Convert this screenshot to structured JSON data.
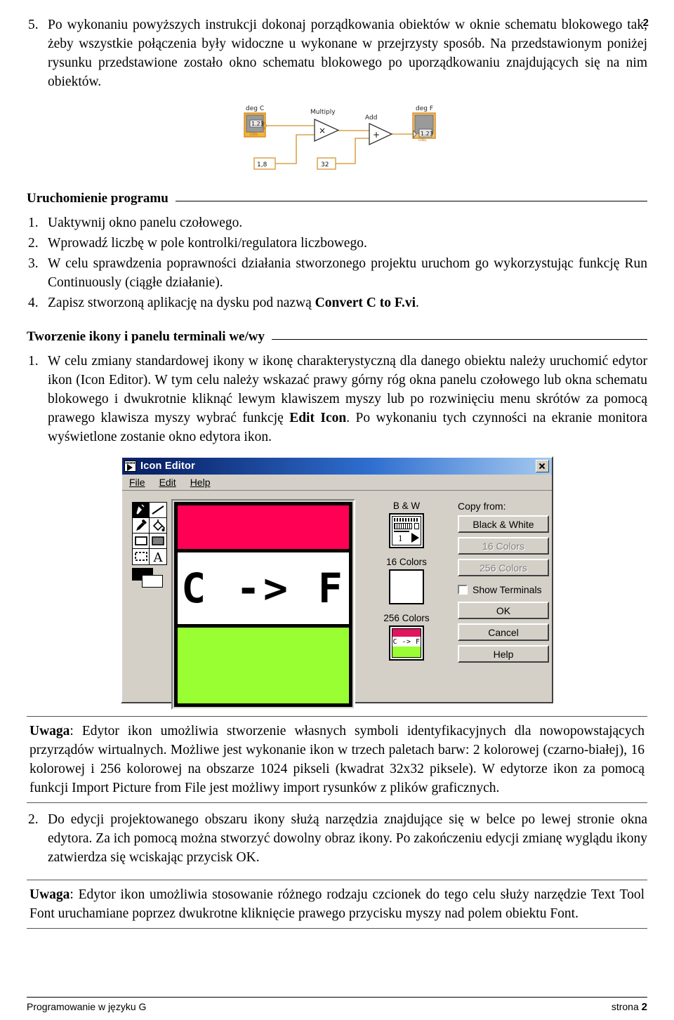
{
  "page": {
    "number_top": "2",
    "footer_left": "Programowanie w języku G",
    "footer_right_label": "strona",
    "footer_right_num": "2"
  },
  "intro": {
    "number": "5.",
    "text": "Po wykonaniu powyższych instrukcji dokonaj porządkowania obiektów w oknie schematu blokowego tak, żeby wszystkie połączenia były widoczne u wykonane w przejrzysty sposób. Na przedstawionym poniżej rysunku przedstawione zostało okno schematu blokowego po uporządkowaniu znajdujących się na nim obiektów."
  },
  "block_diagram": {
    "input_label": "deg C",
    "input_value": "1.23",
    "input_type": "DBL",
    "multiply_label": "Multiply",
    "multiply_symbol": "×",
    "add_label": "Add",
    "add_symbol": "+",
    "constant_multiply": "1,8",
    "constant_add": "32",
    "output_label": "deg F",
    "output_value": "1.23",
    "output_type": "DBL",
    "wire_color": "#e0a030"
  },
  "section_run": {
    "heading": "Uruchomienie programu",
    "items": [
      {
        "num": "1.",
        "text": "Uaktywnij okno panelu czołowego."
      },
      {
        "num": "2.",
        "text": "Wprowadź liczbę w pole kontrolki/regulatora liczbowego."
      },
      {
        "num": "3.",
        "text": "W celu sprawdzenia poprawności działania stworzonego projektu uruchom go wykorzystując funkcję Run Continuously (ciągłe działanie)."
      },
      {
        "num": "4.",
        "text": "Zapisz stworzoną aplikację na dysku pod nazwą ",
        "bold_tail": "Convert C to F.vi",
        "tail": "."
      }
    ]
  },
  "section_icon": {
    "heading": "Tworzenie ikony i panelu terminali we/wy",
    "item1": {
      "num": "1.",
      "part1": "W celu zmiany standardowej ikony w ikonę charakterystyczną dla danego obiektu należy uruchomić edytor ikon (Icon Editor). W tym celu należy wskazać prawy górny róg okna panelu czołowego lub okna schematu blokowego i dwukrotnie kliknąć lewym klawiszem myszy lub po rozwinięciu menu skrótów za pomocą prawego klawisza myszy wybrać funkcję ",
      "bold": "Edit Icon",
      "part2": ". Po wykonaniu tych czynności na ekranie monitora wyświetlone zostanie okno edytora ikon."
    },
    "item2": {
      "num": "2.",
      "text": "Do edycji projektowanego obszaru ikony służą narzędzia znajdujące się w belce po lewej stronie okna edytora. Za ich pomocą można stworzyć dowolny obraz ikony. Po zakończeniu edycji zmianę wyglądu ikony zatwierdza się wciskając przycisk OK."
    }
  },
  "icon_editor": {
    "title": "Icon Editor",
    "menu": [
      "File",
      "Edit",
      "Help"
    ],
    "tools": [
      "pencil-tool",
      "line-tool",
      "eyedropper-tool",
      "fill-tool",
      "rectangle-tool",
      "filled-rectangle-tool",
      "select-tool",
      "text-tool"
    ],
    "foreground_color": "#000000",
    "background_color": "#ffffff",
    "canvas": {
      "top_band_color": "#ff0055",
      "bottom_band_color": "#99ff33",
      "text": "C -> F",
      "text_color": "#000000",
      "border_color": "#000000"
    },
    "previews": [
      {
        "label": "B & W",
        "name": "bw-preview"
      },
      {
        "label": "16 Colors",
        "name": "sixteen-colors-preview"
      },
      {
        "label": "256 Colors",
        "name": "two-fifty-six-colors-preview",
        "icon_text": "C -> F"
      }
    ],
    "copy_from_label": "Copy from:",
    "copy_buttons": [
      {
        "label": "Black & White",
        "disabled": false
      },
      {
        "label": "16 Colors",
        "disabled": true
      },
      {
        "label": "256 Colors",
        "disabled": true
      }
    ],
    "show_terminals": {
      "label": "Show Terminals",
      "checked": false
    },
    "action_buttons": [
      "OK",
      "Cancel",
      "Help"
    ]
  },
  "notes": [
    {
      "prefix": "Uwaga",
      "text": ": Edytor ikon umożliwia stworzenie własnych symboli identyfikacyjnych dla nowopowstających przyrządów wirtualnych. Możliwe jest wykonanie ikon w trzech paletach barw: 2 kolorowej (czarno-białej), 16 kolorowej i 256 kolorowej na obszarze 1024 pikseli (kwadrat 32x32 piksele). W edytorze ikon za pomocą funkcji Import Picture from File jest możliwy import rysunków z plików graficznych."
    },
    {
      "prefix": "Uwaga",
      "text": ": Edytor ikon umożliwia stosowanie różnego rodzaju czcionek do tego celu służy narzędzie Text Tool Font uruchamiane poprzez dwukrotne kliknięcie prawego przycisku myszy nad polem obiektu Font."
    }
  ]
}
